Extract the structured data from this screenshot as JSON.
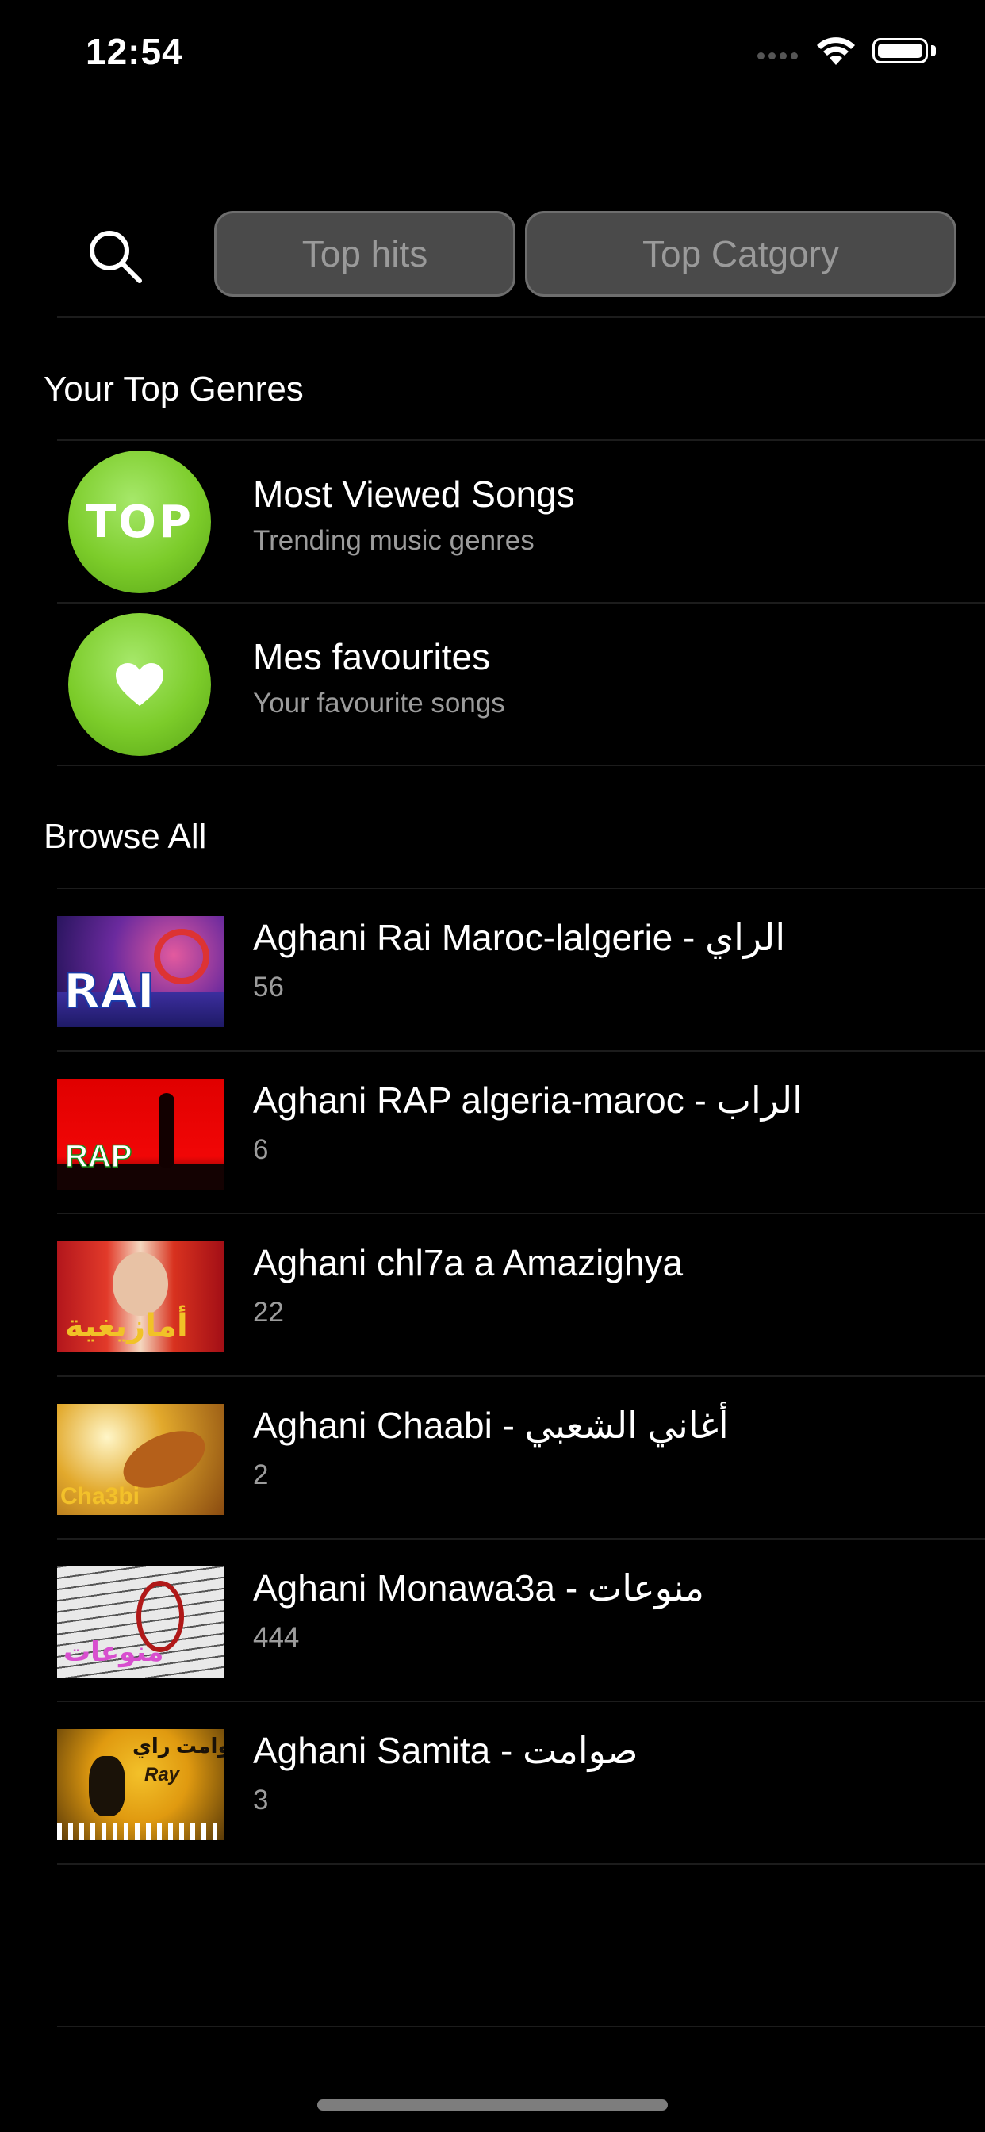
{
  "status": {
    "time": "12:54"
  },
  "search": {
    "top_hits": "Top hits",
    "top_category": "Top Catgory"
  },
  "sections": {
    "top_genres": "Your Top Genres",
    "browse_all": "Browse All"
  },
  "genres": [
    {
      "title": "Most Viewed Songs",
      "subtitle": "Trending music genres",
      "badge": "TOP",
      "icon": "top-badge-icon"
    },
    {
      "title": "Mes favourites",
      "subtitle": "Your favourite songs",
      "icon": "heart-icon"
    }
  ],
  "browse": [
    {
      "title": "Aghani Rai Maroc-lalgerie - الراي",
      "count": "56",
      "thumb_text": "RAI"
    },
    {
      "title": "Aghani RAP algeria-maroc - الراب",
      "count": "6",
      "thumb_text": "RAP"
    },
    {
      "title": "Aghani chl7a a Amazighya",
      "count": "22",
      "thumb_text": "أمازيغية"
    },
    {
      "title": "Aghani Chaabi - أغاني الشعبي",
      "count": "2",
      "thumb_text": "Cha3bi"
    },
    {
      "title": "Aghani Monawa3a - منوعات",
      "count": "444",
      "thumb_text": "منوعات"
    },
    {
      "title": "Aghani Samita - صوامت",
      "count": "3",
      "thumb_text": "صوامت راي",
      "thumb_text2": "Ray"
    }
  ],
  "colors": {
    "background": "#000000",
    "pill_bg": "#4a4a4a",
    "pill_text": "#9a9a9a",
    "accent_green": "#7ccc2a",
    "subtitle": "#9c9c9c"
  }
}
